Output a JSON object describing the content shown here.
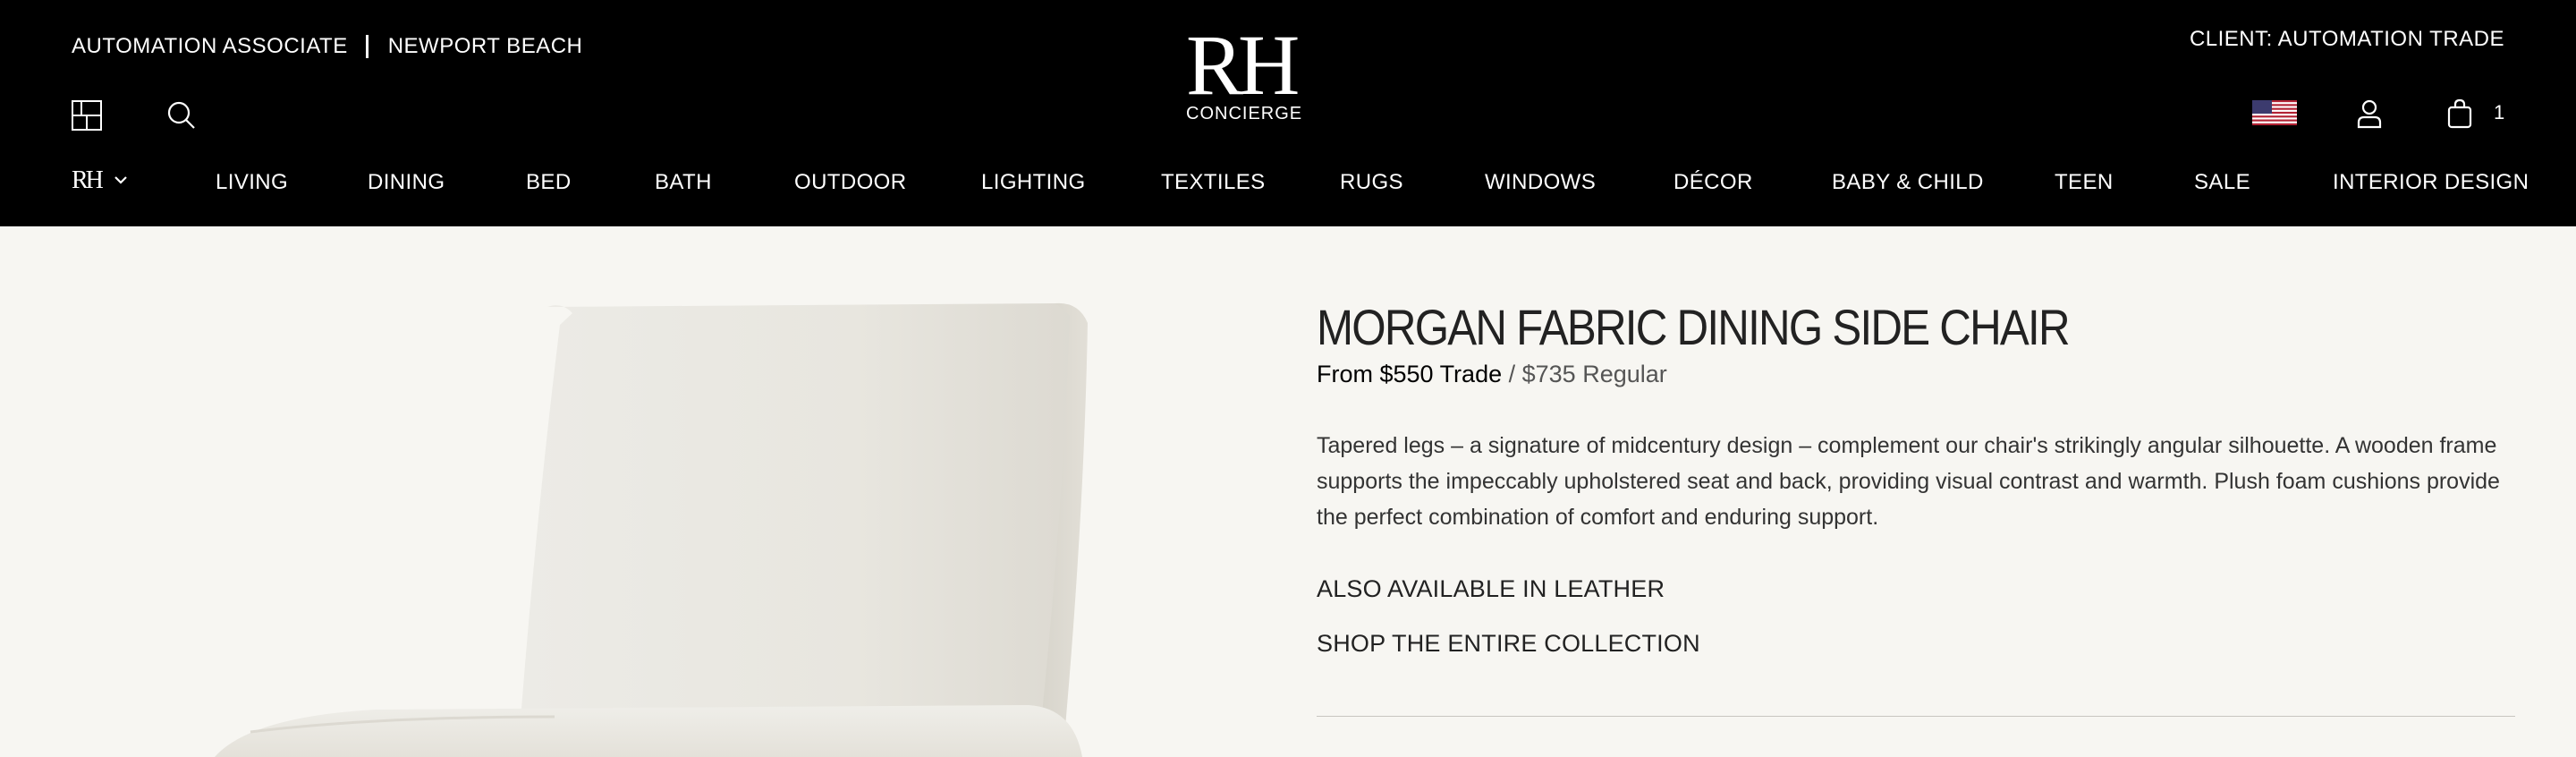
{
  "header": {
    "associate_label": "AUTOMATION ASSOCIATE",
    "location_label": "NEWPORT BEACH",
    "client_label": "CLIENT: AUTOMATION TRADE",
    "logo_text": "RH",
    "logo_subtext": "CONCIERGE",
    "brand_menu_text": "RH",
    "cart_count": "1",
    "icons": {
      "menu": "grid-layout-icon",
      "search": "search-icon",
      "flag": "us-flag-icon",
      "account": "user-icon",
      "cart": "shopping-bag-icon",
      "chevron": "chevron-down-icon"
    }
  },
  "nav": {
    "items": [
      "LIVING",
      "DINING",
      "BED",
      "BATH",
      "OUTDOOR",
      "LIGHTING",
      "TEXTILES",
      "RUGS",
      "WINDOWS",
      "DÉCOR",
      "BABY & CHILD",
      "TEEN",
      "SALE",
      "INTERIOR DESIGN"
    ]
  },
  "product": {
    "title": "MORGAN FABRIC DINING SIDE CHAIR",
    "price_trade": "From $550 Trade",
    "price_separator": " / ",
    "price_regular": "$735 Regular",
    "description": "Tapered legs – a signature of midcentury design – complement our chair's strikingly angular silhouette. A wooden frame supports the impeccably upholstered seat and back, providing visual contrast and warmth. Plush foam cushions provide the perfect combination of comfort and enduring support.",
    "link_leather": "ALSO AVAILABLE IN LEATHER",
    "link_collection": "SHOP THE ENTIRE COLLECTION"
  },
  "colors": {
    "header_bg": "#000000",
    "page_bg": "#f7f6f2",
    "chair_fabric": "#ebe8e1"
  }
}
